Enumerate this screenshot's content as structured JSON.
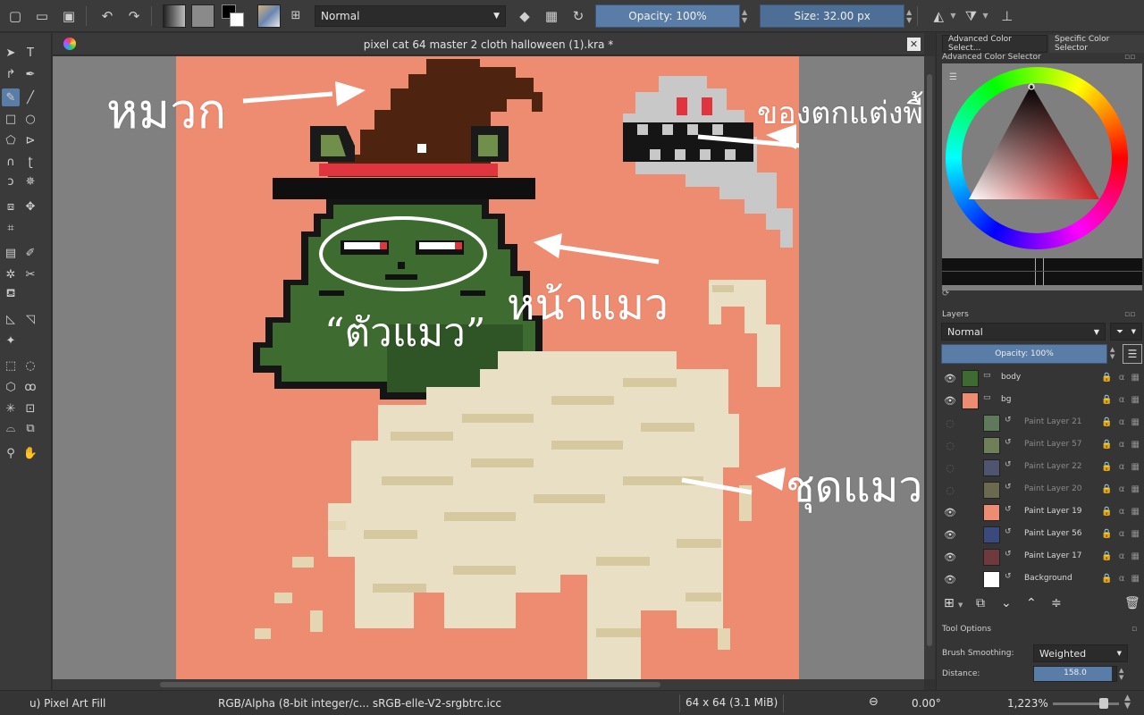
{
  "toolbar": {
    "blend_mode": "Normal",
    "opacity_label": "Opacity: 100%",
    "size_label": "Size: 32.00 px"
  },
  "document": {
    "title": "pixel cat 64 master 2 cloth halloween (1).kra *"
  },
  "annotations": {
    "hat": "หมวก",
    "decor": "ของตกแต่งพื้นหลัง",
    "face": "หน้าแมว",
    "body": "“ตัวแมว”",
    "outfit": "ชุดแมว"
  },
  "color_panel": {
    "tabs": [
      "Advanced Color Select...",
      "Specific Color Selector"
    ],
    "title": "Advanced Color Selector",
    "fg_color": "#000000",
    "bg_color": "#ffffff"
  },
  "layers": {
    "title": "Layers",
    "blend_mode": "Normal",
    "opacity_label": "Opacity:  100%",
    "items": [
      {
        "name": "body",
        "visible": true,
        "color": "#3e6b2f"
      },
      {
        "name": "bg",
        "visible": true,
        "color": "#ee8c72"
      },
      {
        "name": "Paint Layer 21",
        "visible": false,
        "color": "#5f7a5a"
      },
      {
        "name": "Paint Layer 57",
        "visible": false,
        "color": "#6f7f58"
      },
      {
        "name": "Paint Layer 22",
        "visible": false,
        "color": "#4f5570"
      },
      {
        "name": "Paint Layer 20",
        "visible": false,
        "color": "#6b6a4f"
      },
      {
        "name": "Paint Layer 19",
        "visible": true,
        "color": "#ee8c72"
      },
      {
        "name": "Paint Layer 56",
        "visible": true,
        "color": "#3b4a7d"
      },
      {
        "name": "Paint Layer 17",
        "visible": true,
        "color": "#6e3a3e"
      },
      {
        "name": "Background",
        "visible": true,
        "color": "#ffffff"
      }
    ]
  },
  "tool_options": {
    "title": "Tool Options",
    "brush_smoothing_label": "Brush Smoothing:",
    "brush_smoothing_value": "Weighted",
    "distance_label": "Distance:",
    "distance_value": "158.0",
    "distance_fraction": 0.95
  },
  "status": {
    "tool": "u) Pixel Art Fill",
    "color_profile": "RGB/Alpha (8-bit integer/c...  sRGB-elle-V2-srgbtrc.icc",
    "image_size": "64 x 64 (3.1 MiB)",
    "rotation": "0.00°",
    "zoom": "1,223%"
  },
  "colors": {
    "canvas_bg": "#ee8c72",
    "accent": "#5a7da7"
  }
}
